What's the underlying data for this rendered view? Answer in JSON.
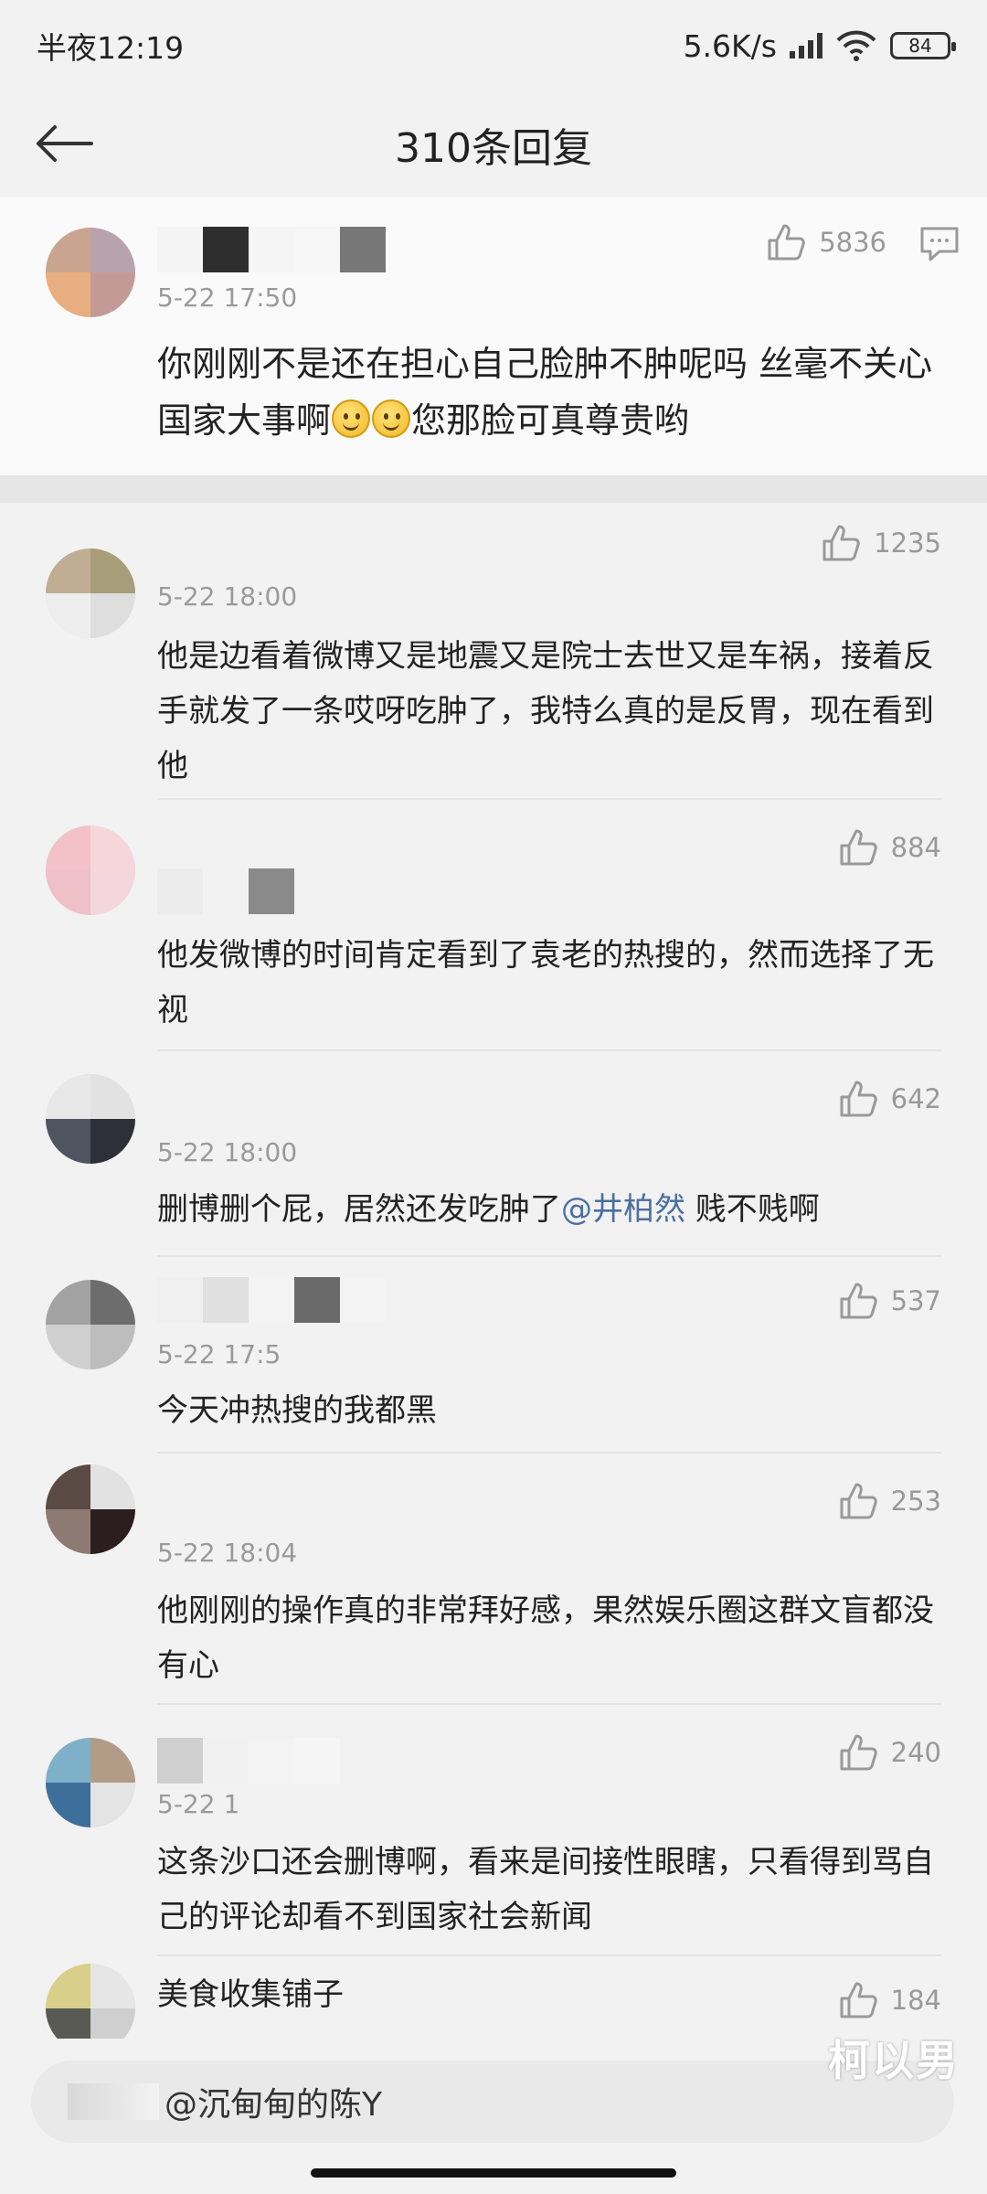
{
  "status_bar": {
    "time": "半夜12:19",
    "net_speed": "5.6K/s",
    "wifi_sub": "6",
    "battery": "84"
  },
  "nav": {
    "title": "310条回复"
  },
  "comments": [
    {
      "time": "5-22 17:50",
      "likes": "5836",
      "text_parts": [
        "你刚刚不是还在担心自己脸肿不肿呢吗 丝毫不关心国家大事啊",
        "您那脸可真尊贵哟"
      ],
      "avatar_colors": [
        "#c9a58f",
        "#b8a3ad",
        "#e9ae7f",
        "#c49a96"
      ]
    },
    {
      "time": "5-22 18:00",
      "likes": "1235",
      "text": "他是边看着微博又是地震又是院士去世又是车祸，接着反手就发了一条哎呀吃肿了，我特么真的是反胃，现在看到他",
      "avatar_colors": [
        "#bfae93",
        "#a89d79",
        "#eeeeee",
        "#dedede"
      ]
    },
    {
      "time": "5-22 18:00",
      "likes": "884",
      "text": "他发微博的时间肯定看到了袁老的热搜的，然而选择了无视",
      "avatar_colors": [
        "#f2c2c8",
        "#f7d6da",
        "#eec0c8",
        "#f4d7dd"
      ]
    },
    {
      "time": "5-22 18:00",
      "likes": "642",
      "text_before": "删博删个屁，居然还发吃肿了",
      "mention": "@井柏然",
      "text_after": " 贱不贱啊",
      "avatar_colors": [
        "#e8e8e8",
        "#e2e2e2",
        "#4f5560",
        "#2d3038"
      ]
    },
    {
      "time": "5-22 17:5",
      "likes": "537",
      "text": "今天冲热搜的我都黑",
      "avatar_colors": [
        "#a2a2a2",
        "#6d6d6d",
        "#cfcfcf",
        "#bdbdbd"
      ]
    },
    {
      "time": "5-22 18:04",
      "likes": "253",
      "text": "他刚刚的操作真的非常拜好感，果然娱乐圈这群文盲都没有心",
      "avatar_colors": [
        "#5a4a44",
        "#e2e2e2",
        "#8d7a72",
        "#2a1e1e"
      ]
    },
    {
      "time": "5-22 1",
      "likes": "240",
      "text": "这条沙口还会删博啊，看来是间接性眼瞎，只看得到骂自己的评论却看不到国家社会新闻",
      "avatar_colors": [
        "#7fb0c9",
        "#b29c88",
        "#3e6f9a",
        "#e4e4e4"
      ]
    },
    {
      "name": "美食收集铺子",
      "likes": "184",
      "avatar_colors": [
        "#d8cf8a",
        "#e6e6e6",
        "#5a5a55",
        "#cfcfcf"
      ]
    }
  ],
  "input": {
    "placeholder": "@沉甸甸的陈Y"
  },
  "watermark": "柯以男",
  "colors": {
    "background": "#f2f2f2",
    "mention": "#4a6f9f",
    "meta": "#9a9a9a"
  }
}
